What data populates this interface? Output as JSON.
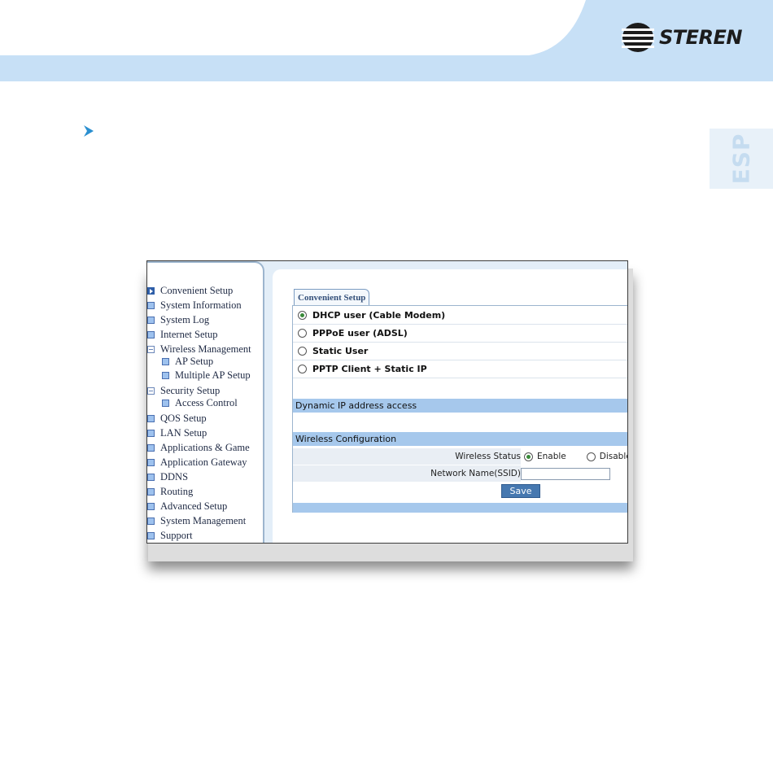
{
  "brand": {
    "name": "STEREN",
    "accent": "#c7e0f6",
    "tab_color": "#e8f1f9"
  },
  "language_tab": {
    "label": "ESP"
  },
  "router_ui": {
    "sidebar": {
      "items": [
        {
          "label": "Convenient Setup",
          "icon": "arrow-icon"
        },
        {
          "label": "System Information",
          "icon": "page-icon"
        },
        {
          "label": "System Log",
          "icon": "page-icon"
        },
        {
          "label": "Internet Setup",
          "icon": "page-icon"
        },
        {
          "label": "Wireless Management",
          "icon": "folder-open-icon"
        },
        {
          "label": "AP Setup",
          "icon": "page-icon",
          "sub": true
        },
        {
          "label": "Multiple AP Setup",
          "icon": "page-icon",
          "sub": true
        },
        {
          "label": "Security Setup",
          "icon": "folder-open-icon"
        },
        {
          "label": "Access Control",
          "icon": "page-icon",
          "sub": true
        },
        {
          "label": "QOS Setup",
          "icon": "page-icon"
        },
        {
          "label": "LAN Setup",
          "icon": "page-icon"
        },
        {
          "label": "Applications & Game",
          "icon": "page-icon"
        },
        {
          "label": "Application Gateway",
          "icon": "page-icon"
        },
        {
          "label": "DDNS",
          "icon": "page-icon"
        },
        {
          "label": "Routing",
          "icon": "page-icon"
        },
        {
          "label": "Advanced Setup",
          "icon": "page-icon"
        },
        {
          "label": "System Management",
          "icon": "page-icon"
        },
        {
          "label": "Support",
          "icon": "page-icon"
        }
      ]
    },
    "tab_label": "Convenient Setup",
    "connection_options": [
      {
        "label": "DHCP user (Cable Modem)",
        "selected": true
      },
      {
        "label": "PPPoE user (ADSL)",
        "selected": false
      },
      {
        "label": "Static User",
        "selected": false
      },
      {
        "label": "PPTP Client + Static IP",
        "selected": false
      }
    ],
    "dynamic_section_title": "Dynamic IP address access",
    "wireless_section_title": "Wireless Configuration",
    "wireless_status": {
      "label": "Wireless Status",
      "enable": "Enable",
      "disable": "Disable",
      "value": "Enable"
    },
    "ssid": {
      "label": "Network Name(SSID)",
      "value": ""
    },
    "save_label": "Save"
  }
}
